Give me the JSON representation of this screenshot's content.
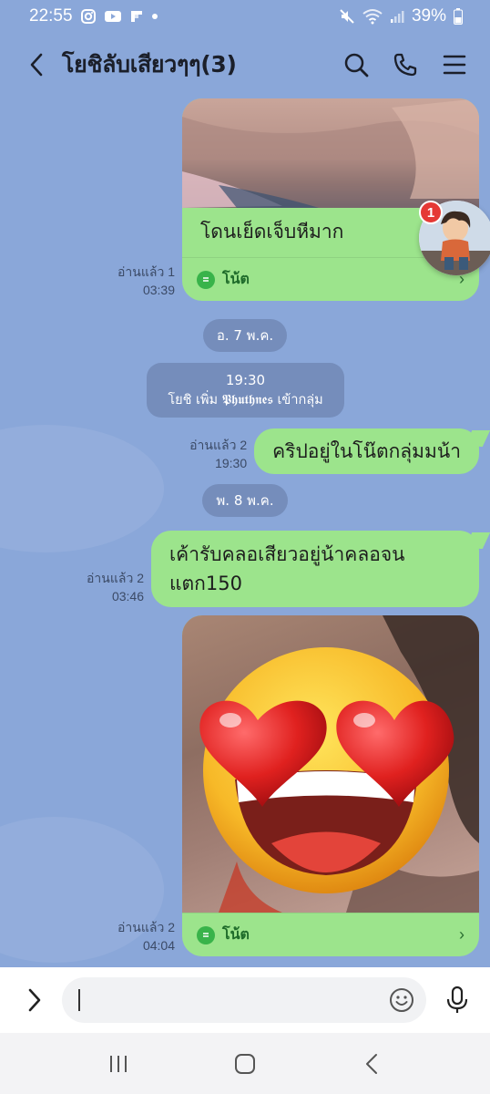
{
  "status_bar": {
    "time": "22:55",
    "battery": "39%",
    "app_icons": [
      "instagram-icon",
      "youtube-icon",
      "flipboard-icon",
      "dot-icon"
    ],
    "system_icons": [
      "mute-icon",
      "wifi-icon",
      "signal-icon",
      "battery-icon"
    ]
  },
  "header": {
    "title": "โยชิลับเสียวๆๆ(3)",
    "icons": [
      "search-icon",
      "phone-icon",
      "menu-icon"
    ]
  },
  "messages": {
    "m1": {
      "read": "อ่านแล้ว 1",
      "time": "03:39",
      "text": "โดนเย็ดเจ็บหีมาก",
      "note_label": "โน้ต"
    },
    "date1": "อ. 7 พ.ค.",
    "system": {
      "time": "19:30",
      "text": "โยชิ เพิ่ม 𝕻𝖍𝖚𝖙𝖍𝖓𝖊𝖘 เข้ากลุ่ม"
    },
    "m2": {
      "read": "อ่านแล้ว 2",
      "time": "19:30",
      "text": "คริปอยู่ในโน๊ตกลุ่มมน้า"
    },
    "date2": "พ. 8 พ.ค.",
    "m3": {
      "read": "อ่านแล้ว 2",
      "time": "03:46",
      "line1": "เค้ารับคลอเสียวอยู่น้าคลอจน",
      "line2": "แตก150"
    },
    "m4": {
      "read": "อ่านแล้ว 2",
      "time": "04:04",
      "note_label": "โน้ต"
    }
  },
  "floating": {
    "badge": "1"
  },
  "input": {
    "value": "",
    "placeholder": ""
  },
  "colors": {
    "background": "#8aa7d9",
    "bubble": "#9ce48c",
    "note_icon": "#39b34a",
    "badge": "#e53935"
  }
}
